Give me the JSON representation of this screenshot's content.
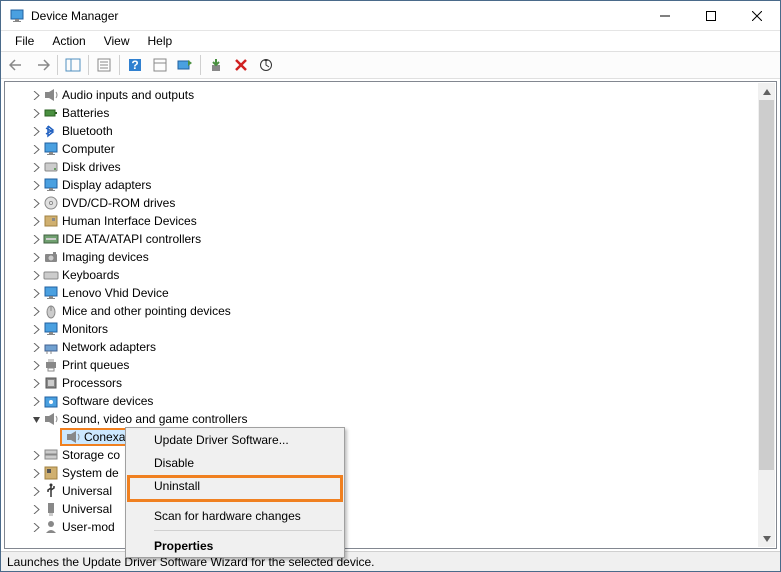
{
  "window": {
    "title": "Device Manager"
  },
  "menu": {
    "file": "File",
    "action": "Action",
    "view": "View",
    "help": "Help"
  },
  "tree": {
    "items": [
      {
        "label": "Audio inputs and outputs",
        "icon": "speaker"
      },
      {
        "label": "Batteries",
        "icon": "battery"
      },
      {
        "label": "Bluetooth",
        "icon": "bluetooth"
      },
      {
        "label": "Computer",
        "icon": "monitor"
      },
      {
        "label": "Disk drives",
        "icon": "disk"
      },
      {
        "label": "Display adapters",
        "icon": "monitor"
      },
      {
        "label": "DVD/CD-ROM drives",
        "icon": "disc"
      },
      {
        "label": "Human Interface Devices",
        "icon": "hid"
      },
      {
        "label": "IDE ATA/ATAPI controllers",
        "icon": "ide"
      },
      {
        "label": "Imaging devices",
        "icon": "camera"
      },
      {
        "label": "Keyboards",
        "icon": "keyboard"
      },
      {
        "label": "Lenovo Vhid Device",
        "icon": "monitor"
      },
      {
        "label": "Mice and other pointing devices",
        "icon": "mouse"
      },
      {
        "label": "Monitors",
        "icon": "monitor"
      },
      {
        "label": "Network adapters",
        "icon": "network"
      },
      {
        "label": "Print queues",
        "icon": "printer"
      },
      {
        "label": "Processors",
        "icon": "cpu"
      },
      {
        "label": "Software devices",
        "icon": "software"
      }
    ],
    "expanded": {
      "label": "Sound, video and game controllers",
      "child": "Conexant SmartAudio HD"
    },
    "after": [
      {
        "label": "Storage co",
        "icon": "storage"
      },
      {
        "label": "System de",
        "icon": "system"
      },
      {
        "label": "Universal",
        "icon": "usb"
      },
      {
        "label": "Universal",
        "icon": "usb2"
      },
      {
        "label": "User-mod",
        "icon": "user"
      }
    ]
  },
  "context_menu": {
    "update": "Update Driver Software...",
    "disable": "Disable",
    "uninstall": "Uninstall",
    "scan": "Scan for hardware changes",
    "properties": "Properties"
  },
  "status": {
    "text": "Launches the Update Driver Software Wizard for the selected device."
  }
}
